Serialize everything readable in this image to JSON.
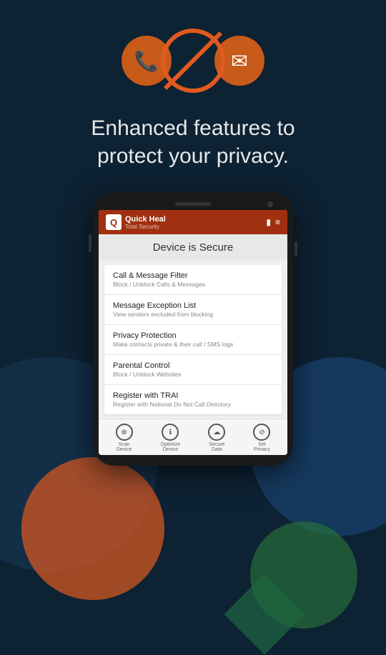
{
  "background": {
    "color": "#0d2233"
  },
  "icons": {
    "phone_icon": "📞",
    "mail_icon": "✉",
    "block_icon": "⊘"
  },
  "headline": {
    "line1": "Enhanced features to",
    "line2": "protect your privacy."
  },
  "app": {
    "logo_letter": "Q",
    "title": "Quick Heal",
    "subtitle": "Total Security",
    "header_icons": [
      "battery",
      "menu"
    ]
  },
  "device_status": "Device is Secure",
  "menu_items": [
    {
      "title": "Call & Message Filter",
      "subtitle": "Block / Unblock Calls & Messages"
    },
    {
      "title": "Message Exception List",
      "subtitle": "View senders excluded from blocking"
    },
    {
      "title": "Privacy Protection",
      "subtitle": "Make contacts private & their call / SMS logs"
    },
    {
      "title": "Parental Control",
      "subtitle": "Block / Unblock Websites"
    },
    {
      "title": "Register with TRAI",
      "subtitle": "Register with National Do Not Call Directory"
    }
  ],
  "bottom_nav": [
    {
      "label": "Scan\nDevice",
      "icon": "⊕"
    },
    {
      "label": "Optimize\nDevice",
      "icon": "ℹ"
    },
    {
      "label": "Secure\nData",
      "icon": "☁"
    },
    {
      "label": "Set\nPrivacy",
      "icon": "⊘"
    }
  ]
}
